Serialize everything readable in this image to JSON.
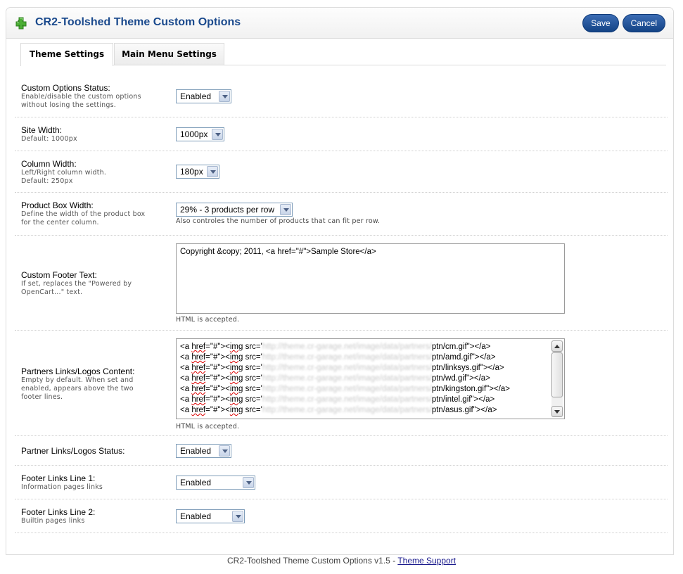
{
  "header": {
    "title": "CR2-Toolshed Theme Custom Options",
    "icon": "puzzle-piece-icon",
    "save_label": "Save",
    "cancel_label": "Cancel"
  },
  "tabs": [
    {
      "label": "Theme Settings",
      "active": true
    },
    {
      "label": "Main Menu Settings",
      "active": false
    }
  ],
  "fields": {
    "custom_options_status": {
      "label": "Custom Options Status:",
      "help": [
        "Enable/disable the custom options",
        "without losing the settings."
      ],
      "value": "Enabled"
    },
    "site_width": {
      "label": "Site Width:",
      "help": [
        "Default: 1000px"
      ],
      "value": "1000px"
    },
    "column_width": {
      "label": "Column Width:",
      "help": [
        "Left/Right column width.",
        "Default: 250px"
      ],
      "value": "180px"
    },
    "product_box_width": {
      "label": "Product Box Width:",
      "help": [
        "Define the width of the product box",
        "for the center column."
      ],
      "value": "29% - 3 products per row",
      "note": "Also controles the number of products that can fit per row."
    },
    "custom_footer_text": {
      "label": "Custom Footer Text:",
      "help": [
        "If set, replaces the \"Powered by",
        "OpenCart...\" text."
      ],
      "value": "Copyright &copy; 2011, <a href=\"#\">Sample Store</a>",
      "note": "HTML is accepted."
    },
    "partners_links": {
      "label": "Partners Links/Logos Content:",
      "help": [
        "Empty by default. When set and",
        "enabled, appears above the two",
        "footer lines."
      ],
      "lines": [
        {
          "pre": "<a ",
          "sq1": "href",
          "mid": "=\"#\"><",
          "sq2": "img",
          "src": " src='",
          "url": "http://theme.cr-garage.net/image/data/partners/",
          "file": "ptn/cm.gif\"></a>"
        },
        {
          "pre": "<a ",
          "sq1": "href",
          "mid": "=\"#\"><",
          "sq2": "img",
          "src": " src='",
          "url": "http://theme.cr-garage.net/image/data/partners/",
          "file": "ptn/amd.gif\"></a>"
        },
        {
          "pre": "<a ",
          "sq1": "href",
          "mid": "=\"#\"><",
          "sq2": "img",
          "src": " src='",
          "url": "http://theme.cr-garage.net/image/data/partners/",
          "file": "ptn/linksys.gif\"></a>"
        },
        {
          "pre": "<a ",
          "sq1": "href",
          "mid": "=\"#\"><",
          "sq2": "img",
          "src": " src='",
          "url": "http://theme.cr-garage.net/image/data/partners/",
          "file": "ptn/wd.gif\"></a>"
        },
        {
          "pre": "<a ",
          "sq1": "href",
          "mid": "=\"#\"><",
          "sq2": "img",
          "src": " src='",
          "url": "http://theme.cr-garage.net/image/data/partners/",
          "file": "ptn/kingston.gif\"></a>"
        },
        {
          "pre": "<a ",
          "sq1": "href",
          "mid": "=\"#\"><",
          "sq2": "img",
          "src": " src='",
          "url": "http://theme.cr-garage.net/image/data/partners/",
          "file": "ptn/intel.gif\"></a>"
        },
        {
          "pre": "<a ",
          "sq1": "href",
          "mid": "=\"#\"><",
          "sq2": "img",
          "src": " src='",
          "url": "http://theme.cr-garage.net/image/data/partners/",
          "file": "ptn/asus.gif\"></a>"
        }
      ],
      "note": "HTML is accepted."
    },
    "partner_links_status": {
      "label": "Partner Links/Logos Status:",
      "value": "Enabled"
    },
    "footer_links_line1": {
      "label": "Footer Links Line 1:",
      "help": [
        "Information pages links"
      ],
      "value": "Enabled"
    },
    "footer_links_line2": {
      "label": "Footer Links Line 2:",
      "help": [
        "Builtin pages links"
      ],
      "value": "Enabled"
    }
  },
  "footer": {
    "text": "CR2-Toolshed Theme Custom Options v1.5 - ",
    "link": "Theme Support"
  }
}
